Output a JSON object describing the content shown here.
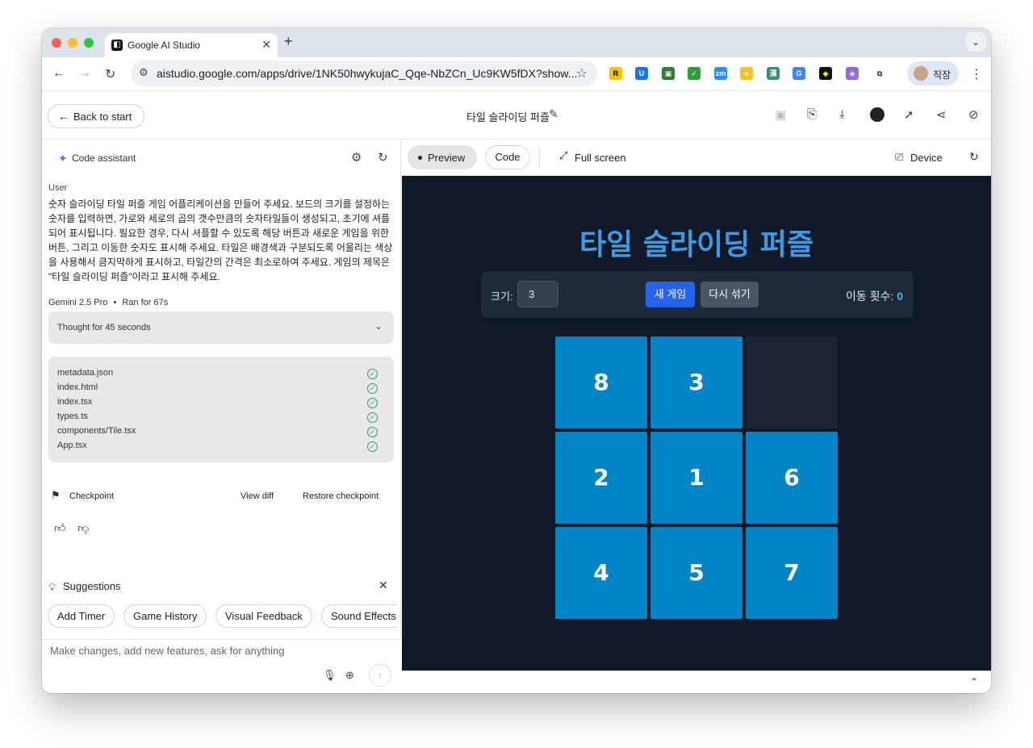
{
  "browser": {
    "tab_title": "Google AI Studio",
    "new_tab": "+",
    "url": "aistudio.google.com/apps/drive/1NK50hwykujaC_Qqe-NbZCn_Uc9KW5fDX?show...",
    "profile_name": "직장",
    "extensions": [
      {
        "label": "R",
        "color": "#f5c400",
        "text_color": "#000000"
      },
      {
        "label": "U",
        "color": "#1a73e8",
        "text_color": "#ffffff"
      },
      {
        "label": "▣",
        "color": "#2e7d32",
        "text_color": "#ffffff"
      },
      {
        "label": "✓",
        "color": "#2e9e3a",
        "text_color": "#ffffff"
      },
      {
        "label": "zm",
        "color": "#2d8cff",
        "text_color": "#ffffff"
      },
      {
        "label": "●",
        "color": "#f6c026",
        "text_color": "#ffffff"
      },
      {
        "label": "漢",
        "color": "#3a8f7a",
        "text_color": "#ffffff"
      },
      {
        "label": "G",
        "color": "#4285f4",
        "text_color": "#ffffff"
      },
      {
        "label": "◆",
        "color": "#111111",
        "text_color": "#c6ff00"
      },
      {
        "label": "◈",
        "color": "#9b6bd6",
        "text_color": "#ffffff"
      },
      {
        "label": "⧉",
        "color": "#ffffff",
        "text_color": "#444444"
      }
    ]
  },
  "header": {
    "back_label": "Back to start",
    "app_title": "타일 슬라이딩 퍼즐"
  },
  "assistant": {
    "title": "Code assistant",
    "user_label": "User",
    "prompt": "숫자 슬라이딩 타일 퍼즐 게임 어플리케이션을 만들어 주세요. 보드의 크기를 설정하는 숫자를 입력하면, 가로와 세로의 곱의 갯수만큼의 숫자타일들이 생성되고, 초기에 셔플되어 표시됩니다. 필요한 경우, 다시 셔플할 수 있도록 해당 버튼과 새로운 게임을 위한 버튼, 그리고 이동한 숫자도 표시해 주세요. 타일은 배경색과 구분되도록 어울리는 색상을 사용해서 큼지막하게 표시하고, 타일간의 간격은 최소로하여 주세요. 게임의 제목은 \"타일 슬라이딩 퍼즐\"이라고 표시해 주세요.",
    "model": "Gemini 2.5 Pro",
    "bullet": "•",
    "run_time": "Ran for 67s",
    "thought_label": "Thought for 45 seconds",
    "files": [
      "metadata.json",
      "index.html",
      "index.tsx",
      "types.ts",
      "components/Tile.tsx",
      "App.tsx"
    ],
    "checkpoint_label": "Checkpoint",
    "view_diff": "View diff",
    "restore_checkpoint": "Restore checkpoint",
    "suggestions_label": "Suggestions",
    "suggestions": [
      "Add Timer",
      "Game History",
      "Visual Feedback",
      "Sound Effects"
    ],
    "input_placeholder": "Make changes, add new features, ask for anything"
  },
  "preview": {
    "tab_preview": "Preview",
    "tab_code": "Code",
    "full_screen": "Full screen",
    "device": "Device",
    "game": {
      "title": "타일 슬라이딩 퍼즐",
      "size_label": "크기:",
      "size_value": "3",
      "new_game": "새 게임",
      "shuffle": "다시 섞기",
      "moves_label": "이동 횟수:",
      "moves_value": "0",
      "tiles": [
        "8",
        "3",
        "",
        "2",
        "1",
        "6",
        "4",
        "5",
        "7"
      ]
    }
  },
  "colors": {
    "stage_bg": "#111827",
    "tile": "#0284c7",
    "title": "#3b9be6",
    "accent_button": "#2563eb",
    "moves_value": "#38bdf8"
  }
}
